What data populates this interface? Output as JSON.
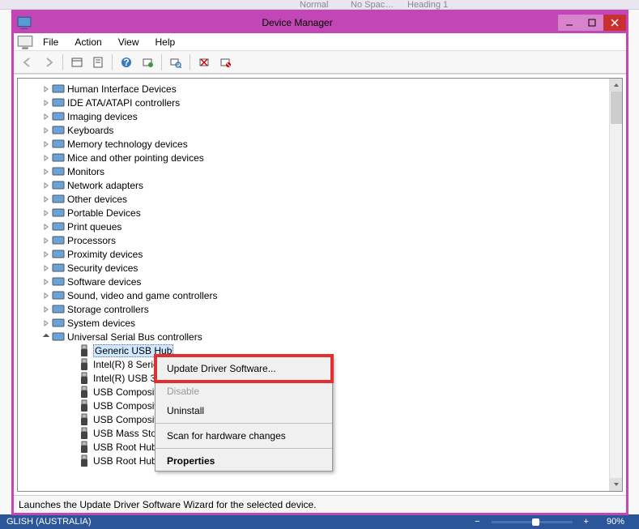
{
  "background": {
    "word_snippets": {
      "a": "Normal",
      "b": "No Spac…",
      "c": "Heading 1"
    },
    "status_lang": "GLISH (AUSTRALIA)",
    "zoom_percent": "90%"
  },
  "window": {
    "title": "Device Manager"
  },
  "menubar": [
    "File",
    "Action",
    "View",
    "Help"
  ],
  "toolbar": [
    {
      "name": "back-icon",
      "disabled": true
    },
    {
      "name": "forward-icon",
      "disabled": true
    },
    {
      "name": "sep"
    },
    {
      "name": "show-hidden-devices-icon",
      "disabled": false
    },
    {
      "name": "properties-icon",
      "disabled": false
    },
    {
      "name": "sep"
    },
    {
      "name": "help-icon",
      "disabled": false
    },
    {
      "name": "update-driver-toolbar-icon",
      "disabled": false
    },
    {
      "name": "sep"
    },
    {
      "name": "scan-hardware-icon",
      "disabled": false
    },
    {
      "name": "sep"
    },
    {
      "name": "uninstall-toolbar-icon",
      "disabled": false
    },
    {
      "name": "disable-toolbar-icon",
      "disabled": false
    }
  ],
  "tree": {
    "categories": [
      {
        "label": "Human Interface Devices",
        "icon": "hid-icon"
      },
      {
        "label": "IDE ATA/ATAPI controllers",
        "icon": "ide-icon"
      },
      {
        "label": "Imaging devices",
        "icon": "imaging-icon"
      },
      {
        "label": "Keyboards",
        "icon": "keyboard-icon"
      },
      {
        "label": "Memory technology devices",
        "icon": "memory-icon"
      },
      {
        "label": "Mice and other pointing devices",
        "icon": "mouse-icon"
      },
      {
        "label": "Monitors",
        "icon": "monitor-icon"
      },
      {
        "label": "Network adapters",
        "icon": "network-icon"
      },
      {
        "label": "Other devices",
        "icon": "other-icon"
      },
      {
        "label": "Portable Devices",
        "icon": "portable-icon"
      },
      {
        "label": "Print queues",
        "icon": "print-icon"
      },
      {
        "label": "Processors",
        "icon": "processor-icon"
      },
      {
        "label": "Proximity devices",
        "icon": "proximity-icon"
      },
      {
        "label": "Security devices",
        "icon": "security-icon"
      },
      {
        "label": "Software devices",
        "icon": "software-icon"
      },
      {
        "label": "Sound, video and game controllers",
        "icon": "sound-icon"
      },
      {
        "label": "Storage controllers",
        "icon": "storage-icon"
      },
      {
        "label": "System devices",
        "icon": "system-icon"
      }
    ],
    "expanded_category": {
      "label": "Universal Serial Bus controllers",
      "icon": "usb-icon",
      "children": [
        {
          "label": "Generic USB Hub",
          "selected": true
        },
        {
          "label": "Intel(R) 8 Series"
        },
        {
          "label": "Intel(R) USB 3.0"
        },
        {
          "label": "USB Composite"
        },
        {
          "label": "USB Composite"
        },
        {
          "label": "USB Composite"
        },
        {
          "label": "USB Mass Storage Device"
        },
        {
          "label": "USB Root Hub"
        },
        {
          "label": "USB Root Hub (xHCI)"
        }
      ]
    }
  },
  "context_menu": {
    "items": [
      {
        "label": "Update Driver Software...",
        "name": "ctx-update-driver",
        "highlighted": true
      },
      {
        "label": "Disable",
        "name": "ctx-disable",
        "disabled": true
      },
      {
        "label": "Uninstall",
        "name": "ctx-uninstall"
      },
      {
        "sep": true
      },
      {
        "label": "Scan for hardware changes",
        "name": "ctx-scan-hardware"
      },
      {
        "sep": true
      },
      {
        "label": "Properties",
        "name": "ctx-properties",
        "bold": true
      }
    ]
  },
  "statusbar": {
    "text": "Launches the Update Driver Software Wizard for the selected device."
  }
}
